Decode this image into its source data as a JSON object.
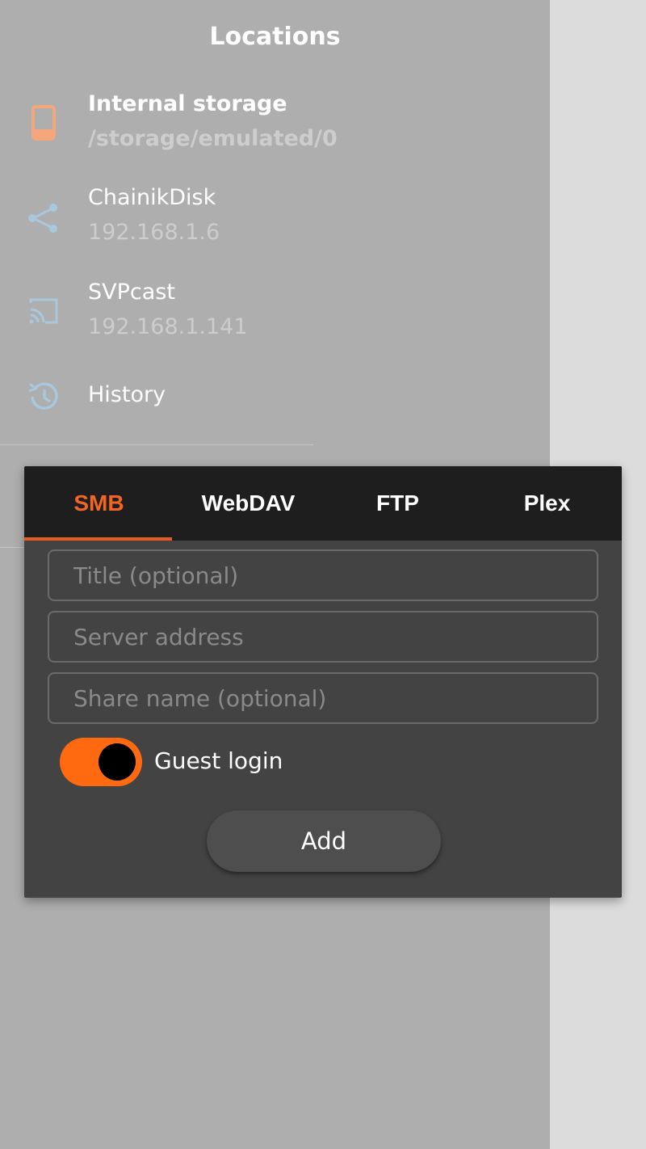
{
  "drawer": {
    "title": "Locations",
    "items": [
      {
        "name": "Internal storage",
        "sub": "/storage/emulated/0",
        "icon": "phone-icon"
      },
      {
        "name": "ChainikDisk",
        "sub": "192.168.1.6",
        "icon": "share-network-icon"
      },
      {
        "name": "SVPcast",
        "sub": "192.168.1.141",
        "icon": "cast-icon"
      },
      {
        "name": "History",
        "sub": "",
        "icon": "history-icon"
      }
    ]
  },
  "dialog": {
    "tabs": [
      "SMB",
      "WebDAV",
      "FTP",
      "Plex"
    ],
    "active_tab": "SMB",
    "fields": {
      "title_placeholder": "Title (optional)",
      "server_placeholder": "Server address",
      "share_placeholder": "Share name (optional)"
    },
    "guest_login": {
      "label": "Guest login",
      "enabled": true
    },
    "add_label": "Add"
  },
  "colors": {
    "accent": "#f26522",
    "toggle_track": "#ff6a10",
    "icon_orange": "#f5a77b",
    "icon_blue": "#a9c7dd"
  }
}
